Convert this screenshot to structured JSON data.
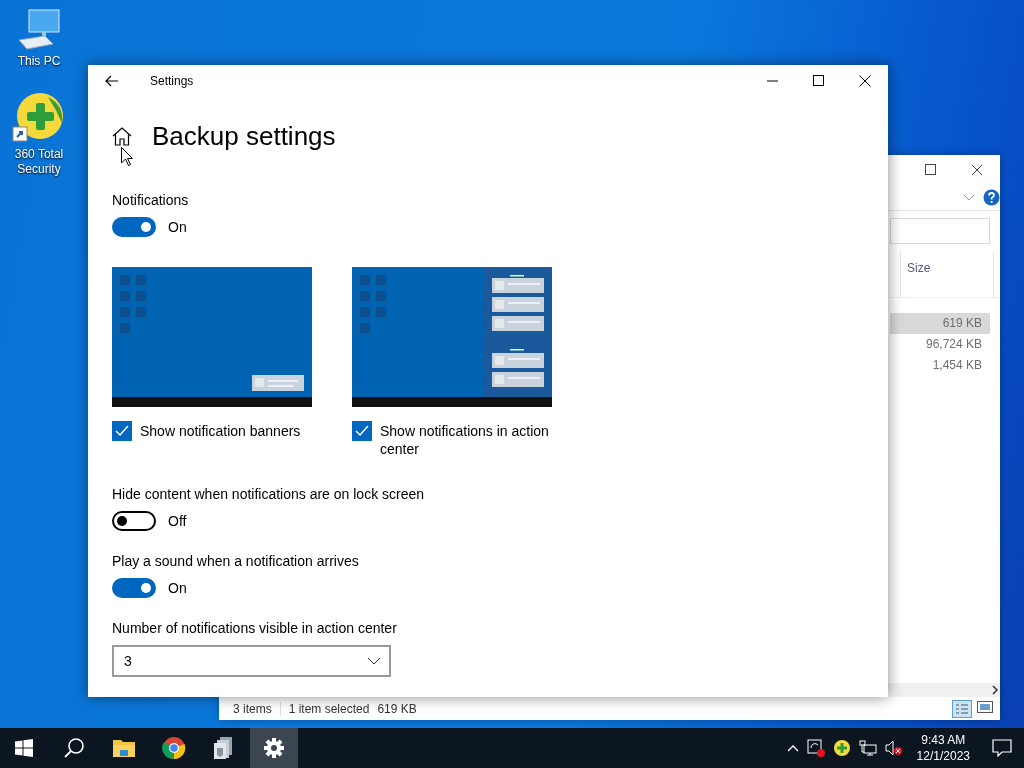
{
  "desktop_icons": [
    {
      "label": "This PC",
      "kind": "computer"
    },
    {
      "label": "360 Total Security",
      "kind": "security-app"
    }
  ],
  "explorer": {
    "size_column": "Size",
    "rows": [
      {
        "size": "619 KB",
        "selected": true
      },
      {
        "size": "96,724 KB",
        "selected": false
      },
      {
        "size": "1,454 KB",
        "selected": false
      }
    ],
    "status_bar": {
      "item_count": "3 items",
      "selection": "1 item selected",
      "selection_size": "619 KB"
    }
  },
  "settings": {
    "window_title": "Settings",
    "page_title": "Backup settings",
    "sections": [
      {
        "kind": "toggle",
        "label": "Notifications",
        "on": true,
        "state_text": "On"
      },
      {
        "kind": "previews",
        "items": [
          {
            "kind": "banner",
            "label": "Show notification banners",
            "checked": true
          },
          {
            "kind": "action-center",
            "label": "Show notifications in action center",
            "checked": true
          }
        ]
      },
      {
        "kind": "toggle",
        "label": "Hide content when notifications are on lock screen",
        "on": false,
        "state_text": "Off"
      },
      {
        "kind": "toggle",
        "label": "Play a sound when a notification arrives",
        "on": true,
        "state_text": "On"
      },
      {
        "kind": "dropdown",
        "label": "Number of notifications visible in action center",
        "value": "3"
      }
    ]
  },
  "taskbar": {
    "apps": [
      {
        "kind": "start",
        "selected": false
      },
      {
        "kind": "search",
        "selected": false
      },
      {
        "kind": "folder",
        "selected": false
      },
      {
        "kind": "browser",
        "selected": false
      },
      {
        "kind": "archive",
        "selected": false
      },
      {
        "kind": "gear",
        "selected": true
      }
    ],
    "time": "9:43 AM",
    "date": "12/1/2023"
  }
}
